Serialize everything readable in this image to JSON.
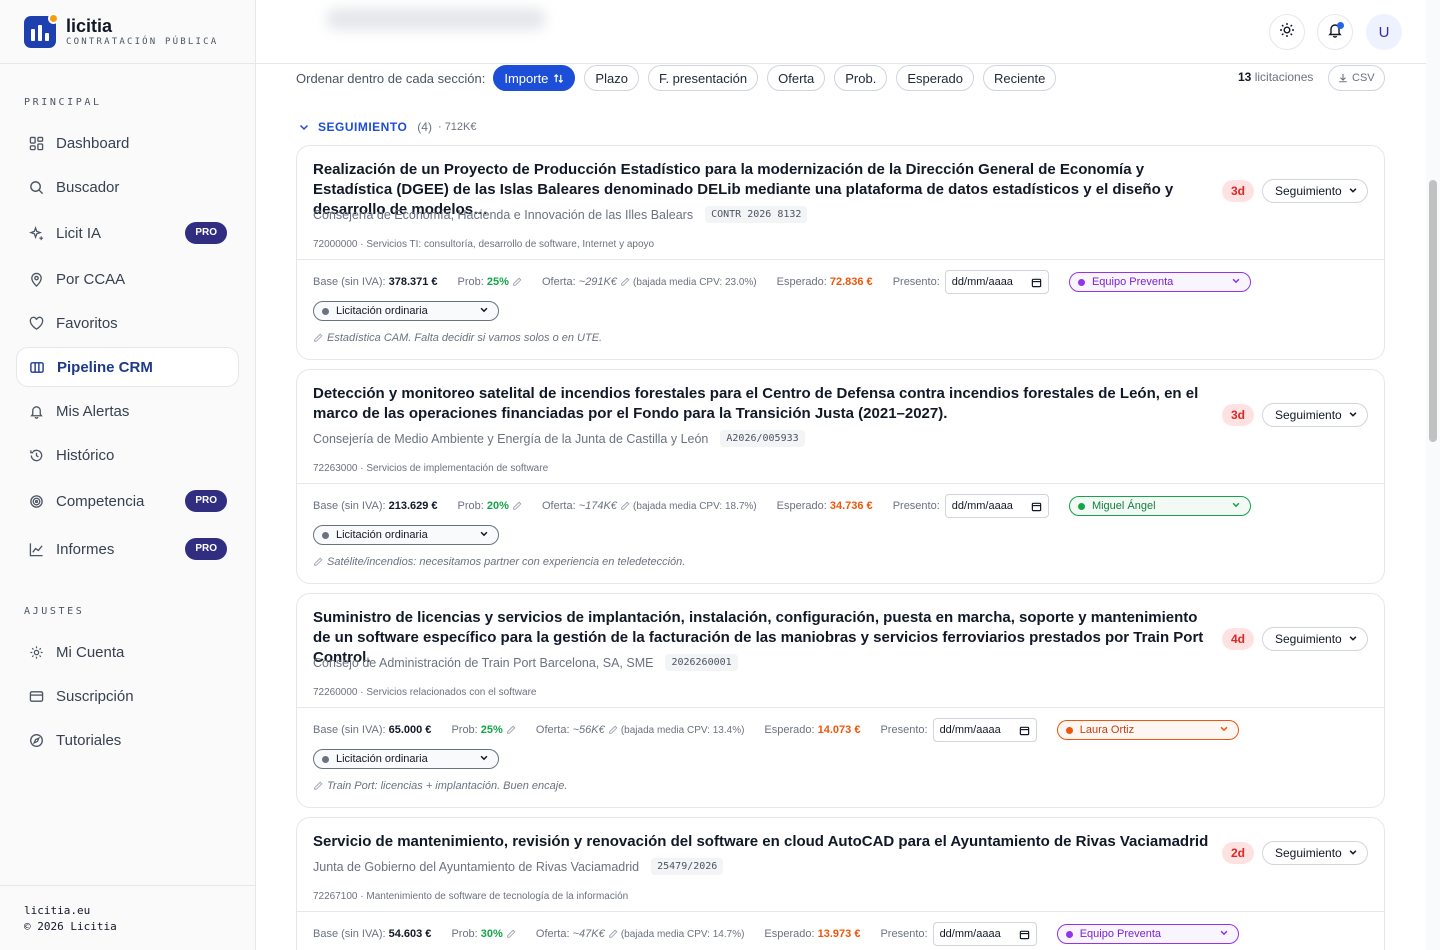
{
  "brand": {
    "name": "licitia",
    "subtitle": "CONTRATACIÓN PÚBLICA"
  },
  "sidebar": {
    "section_main": "PRINCIPAL",
    "items": [
      {
        "label": "Dashboard",
        "icon": "grid-icon"
      },
      {
        "label": "Buscador",
        "icon": "search-icon"
      },
      {
        "label": "Licit IA",
        "icon": "sparkle-icon",
        "badge": "PRO"
      },
      {
        "label": "Por CCAA",
        "icon": "map-pin-icon"
      },
      {
        "label": "Favoritos",
        "icon": "heart-icon"
      },
      {
        "label": "Pipeline CRM",
        "icon": "kanban-icon",
        "active": true
      },
      {
        "label": "Mis Alertas",
        "icon": "bell-icon"
      },
      {
        "label": "Histórico",
        "icon": "history-icon"
      },
      {
        "label": "Competencia",
        "icon": "target-icon",
        "badge": "PRO"
      },
      {
        "label": "Informes",
        "icon": "chart-icon",
        "badge": "PRO"
      }
    ],
    "section_settings": "AJUSTES",
    "settings": [
      {
        "label": "Mi Cuenta",
        "icon": "gear-icon"
      },
      {
        "label": "Suscripción",
        "icon": "card-icon"
      },
      {
        "label": "Tutoriales",
        "icon": "compass-icon"
      }
    ],
    "footer_site": "licitia.eu",
    "footer_copy": "© 2026 Licitia"
  },
  "header": {
    "avatar": "U"
  },
  "sort": {
    "label": "Ordenar dentro de cada sección:",
    "options": [
      "Importe",
      "Plazo",
      "F. presentación",
      "Oferta",
      "Prob.",
      "Esperado",
      "Reciente"
    ],
    "active": "Importe",
    "count_num": "13",
    "count_label": "licitaciones",
    "csv": "CSV"
  },
  "section": {
    "name": "SEGUIMIENTO",
    "count": "(4)",
    "amount": "· 712K€"
  },
  "labels": {
    "base": "Base (sin IVA):",
    "prob": "Prob:",
    "oferta": "Oferta:",
    "esperado": "Esperado:",
    "presentado": "Presento:",
    "date_placeholder": "dd/mm/aaaa"
  },
  "cards": [
    {
      "title": "Realización de un Proyecto de Producción Estadístico para la modernización de la Dirección General de Economía y Estadística (DGEE) de las Islas Baleares denominado DELib mediante una plataforma de datos estadísticos y el diseño y desarrollo de modelos…",
      "org": "Consejería de Economía, Hacienda e Innovación de las Illes Balears",
      "ref": "CONTR 2026 8132",
      "cpv": "72000000 · Servicios TI: consultoría, desarrollo de software, Internet y apoyo",
      "days": "3d",
      "stage": "Seguimiento",
      "base": "378.371 €",
      "prob": "25%",
      "oferta": "~291K€",
      "bajada": "(bajada media CPV: 23.0%)",
      "esperado": "72.836 €",
      "assignee": "Equipo Preventa",
      "assignee_color": "#9333ea",
      "assignee_text": "#7e22ce",
      "tipo": "Licitación ordinaria",
      "note": "Estadística CAM. Falta decidir si vamos solos o en UTE."
    },
    {
      "title": "Detección y monitoreo satelital de incendios forestales para el Centro de Defensa contra incendios forestales de León, en el marco de las operaciones financiadas por el Fondo para la Transición Justa (2021–2027).",
      "org": "Consejería de Medio Ambiente y Energía de la Junta de Castilla y León",
      "ref": "A2026/005933",
      "cpv": "72263000 · Servicios de implementación de software",
      "days": "3d",
      "stage": "Seguimiento",
      "base": "213.629 €",
      "prob": "20%",
      "oferta": "~174K€",
      "bajada": "(bajada media CPV: 18.7%)",
      "esperado": "34.736 €",
      "assignee": "Miguel Ángel",
      "assignee_color": "#16a34a",
      "assignee_text": "#15803d",
      "tipo": "Licitación ordinaria",
      "note": "Satélite/incendios: necesitamos partner con experiencia en teledetección."
    },
    {
      "title": "Suministro de licencias y servicios de implantación, instalación, configuración, puesta en marcha, soporte y mantenimiento de un software específico para la gestión de la facturación de las maniobras y servicios ferroviarios prestados por Train Port Control.",
      "org": "Consejo de Administración de Train Port Barcelona, SA, SME",
      "ref": "2026260001",
      "cpv": "72260000 · Servicios relacionados con el software",
      "days": "4d",
      "stage": "Seguimiento",
      "base": "65.000 €",
      "prob": "25%",
      "oferta": "~56K€",
      "bajada": "(bajada media CPV: 13.4%)",
      "esperado": "14.073 €",
      "assignee": "Laura Ortiz",
      "assignee_color": "#ea580c",
      "assignee_text": "#c2410c",
      "tipo": "Licitación ordinaria",
      "note": "Train Port: licencias + implantación. Buen encaje."
    },
    {
      "title": "Servicio de mantenimiento, revisión y renovación del software en cloud AutoCAD para el Ayuntamiento de Rivas Vaciamadrid",
      "org": "Junta de Gobierno del Ayuntamiento de Rivas Vaciamadrid",
      "ref": "25479/2026",
      "cpv": "72267100 · Mantenimiento de software de tecnología de la información",
      "days": "2d",
      "stage": "Seguimiento",
      "base": "54.603 €",
      "prob": "30%",
      "oferta": "~47K€",
      "bajada": "(bajada media CPV: 14.7%)",
      "esperado": "13.973 €",
      "assignee": "Equipo Preventa",
      "assignee_color": "#9333ea",
      "assignee_text": "#7e22ce"
    }
  ]
}
